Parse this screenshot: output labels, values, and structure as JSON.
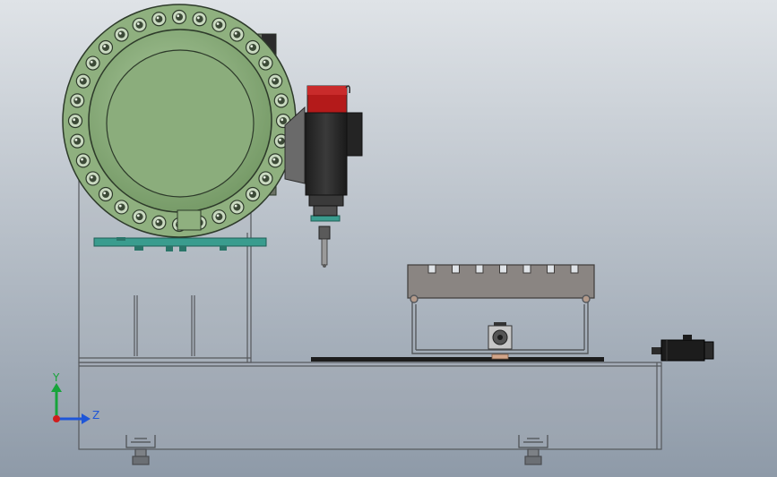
{
  "viewport": {
    "background_top": "#dfe3e7",
    "background_bottom": "#8e9aa8"
  },
  "colors": {
    "magazine_green": "#8fb07f",
    "magazine_inner": "#7fa06e",
    "magazine_outline": "#2d3a2a",
    "teal_plate": "#3a9c8e",
    "spindle_red": "#b41a1a",
    "spindle_dark": "#2b2b2b",
    "fixture_gray": "#8a8582",
    "frame_line": "#55585c",
    "servo_black": "#1c1c1c",
    "axis_y": "#17a43a",
    "axis_z": "#1e56d8",
    "axis_x": "#d11d1d"
  },
  "triad": {
    "y_label": "Y",
    "z_label": "Z"
  },
  "model": {
    "tool_pockets": 32,
    "fixture_slots": 7,
    "leveling_feet": 2
  }
}
